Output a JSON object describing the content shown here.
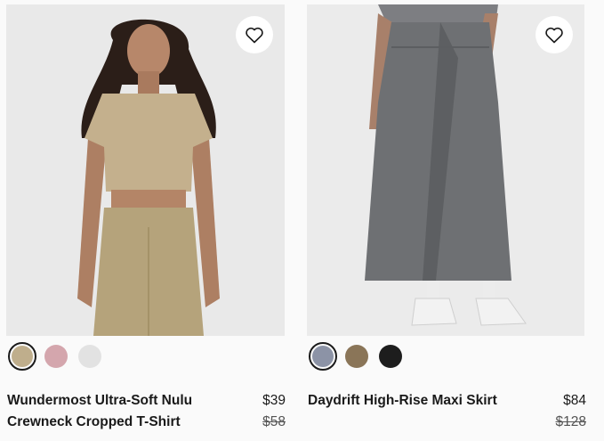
{
  "products": [
    {
      "name": "Wundermost Ultra-Soft Nulu Crewneck Cropped T-Shirt",
      "price": "$39",
      "original_price": "$58",
      "favorite_icon": "heart-outline-icon",
      "swatches": [
        {
          "color": "#bfae8c",
          "selected": true
        },
        {
          "color": "#d4a6ad",
          "selected": false
        },
        {
          "color": "#e2e2e2",
          "selected": false
        }
      ]
    },
    {
      "name": "Daydrift High-Rise Maxi Skirt",
      "price": "$84",
      "original_price": "$128",
      "favorite_icon": "heart-outline-icon",
      "swatches": [
        {
          "color": "#8c93a6",
          "selected": true
        },
        {
          "color": "#8a7558",
          "selected": false
        },
        {
          "color": "#1d1d1d",
          "selected": false
        }
      ]
    }
  ]
}
